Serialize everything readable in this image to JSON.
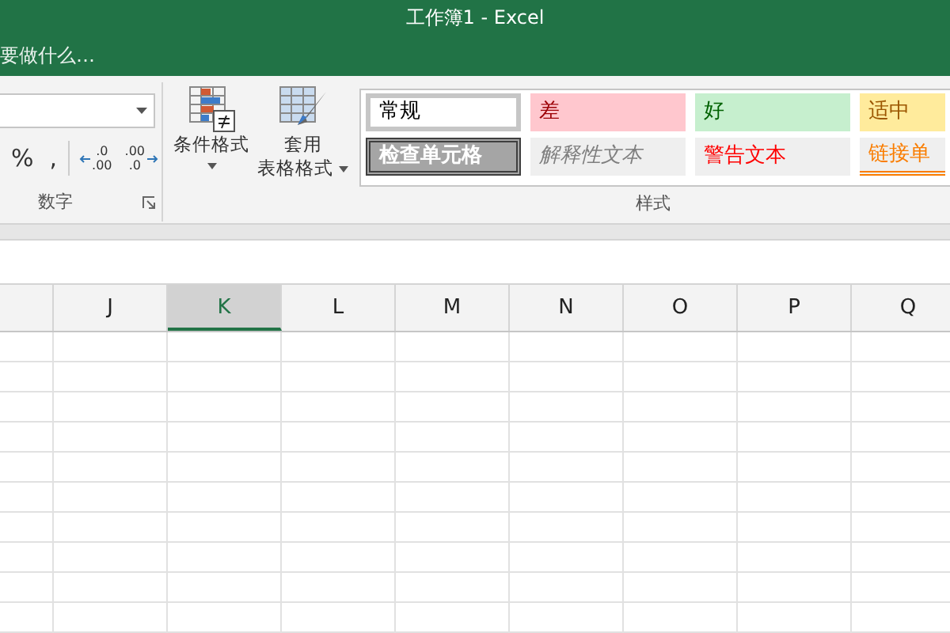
{
  "window": {
    "title": "工作簿1 - Excel"
  },
  "tell_me": {
    "placeholder": "要做什么…"
  },
  "number_group": {
    "label": "数字",
    "buttons": [
      {
        "label": "%"
      },
      {
        "label": ","
      }
    ],
    "decimal_buttons": [
      {
        "kind": "increase",
        "top": ".0",
        "bottom": ".00"
      },
      {
        "kind": "decrease",
        "top": ".00",
        "bottom": ".0"
      }
    ]
  },
  "commands": [
    {
      "kind": "conditional",
      "lines": [
        "条件格式"
      ]
    },
    {
      "kind": "table",
      "lines": [
        "套用",
        "表格格式"
      ]
    }
  ],
  "styles": {
    "label": "样式",
    "cells": [
      {
        "kind": "normal",
        "text": "常规"
      },
      {
        "kind": "bad",
        "text": "差"
      },
      {
        "kind": "good",
        "text": "好"
      },
      {
        "kind": "neutral",
        "text": "适中"
      },
      {
        "kind": "check",
        "text": "检查单元格"
      },
      {
        "kind": "explanatory",
        "text": "解释性文本"
      },
      {
        "kind": "warning",
        "text": "警告文本"
      },
      {
        "kind": "linked",
        "text": "链接单"
      }
    ]
  },
  "columns": [
    {
      "label": "J",
      "selected": false
    },
    {
      "label": "K",
      "selected": true
    },
    {
      "label": "L",
      "selected": false
    },
    {
      "label": "M",
      "selected": false
    },
    {
      "label": "N",
      "selected": false
    },
    {
      "label": "O",
      "selected": false
    },
    {
      "label": "P",
      "selected": false
    },
    {
      "label": "Q",
      "selected": false
    }
  ]
}
